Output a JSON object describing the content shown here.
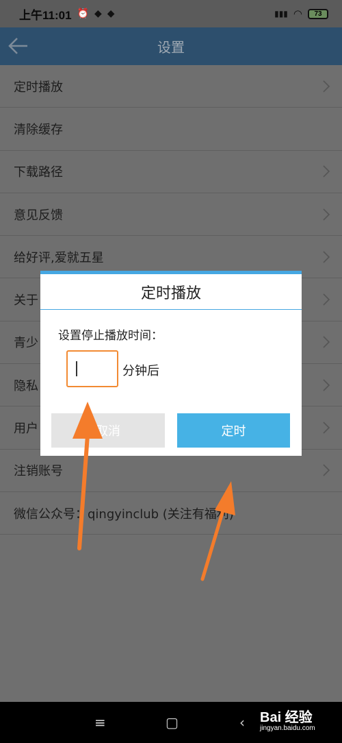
{
  "status_bar": {
    "time": "上午11:01",
    "icons": [
      "alarm-icon",
      "app-notification-icon",
      "app-notification-icon"
    ],
    "right_icons": [
      "hd-signal-icon",
      "wifi-icon"
    ],
    "battery": "73"
  },
  "header": {
    "title": "设置"
  },
  "settings": {
    "items": [
      {
        "label": "定时播放",
        "chevron": true
      },
      {
        "label": "清除缓存",
        "chevron": false
      },
      {
        "label": "下载路径",
        "chevron": true
      },
      {
        "label": "意见反馈",
        "chevron": true
      },
      {
        "label": "给好评,爱就五星",
        "chevron": true
      },
      {
        "label": "关于",
        "chevron": true
      },
      {
        "label": "青少",
        "chevron": true
      },
      {
        "label": "隐私",
        "chevron": true
      },
      {
        "label": "用户",
        "chevron": true
      },
      {
        "label": "注销账号",
        "chevron": true
      },
      {
        "label": "微信公众号：qingyinclub (关注有福利)",
        "chevron": false
      }
    ]
  },
  "dialog": {
    "title": "定时播放",
    "prompt": "设置停止播放时间：",
    "input_value": "",
    "unit": "分钟后",
    "cancel_label": "取消",
    "confirm_label": "定时"
  },
  "colors": {
    "accent": "#46a7e2",
    "input_border": "#f28a32",
    "arrow": "#f47c2b"
  },
  "watermark": {
    "main": "Bai 经验",
    "sub": "jingyan.baidu.com"
  }
}
